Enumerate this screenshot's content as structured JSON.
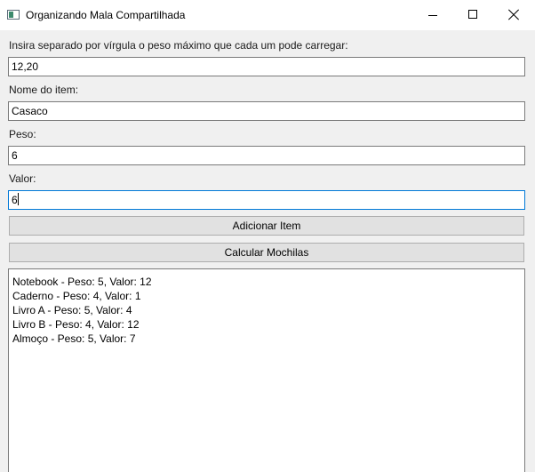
{
  "window": {
    "title": "Organizando Mala Compartilhada",
    "icon": "window-app-icon",
    "controls": [
      "minimize-icon",
      "maximize-icon",
      "close-icon"
    ]
  },
  "form": {
    "capacities_label": "Insira separado por vírgula o peso máximo que cada um pode carregar:",
    "capacities_value": "12,20",
    "item_name_label": "Nome do item:",
    "item_name_value": "Casaco",
    "weight_label": "Peso:",
    "weight_value": "6",
    "value_label": "Valor:",
    "value_value": "6"
  },
  "buttons": {
    "add_item": "Adicionar Item",
    "calculate": "Calcular Mochilas"
  },
  "items_list": [
    "Notebook - Peso: 5, Valor: 12",
    "Caderno - Peso: 4, Valor: 1",
    "Livro A - Peso: 5, Valor: 4",
    "Livro B - Peso: 4, Valor: 12",
    "Almoço - Peso: 5, Valor: 7"
  ],
  "colors": {
    "focus_border": "#0078d7",
    "button_face": "#e1e1e1",
    "window_background": "#f0f0f0"
  }
}
